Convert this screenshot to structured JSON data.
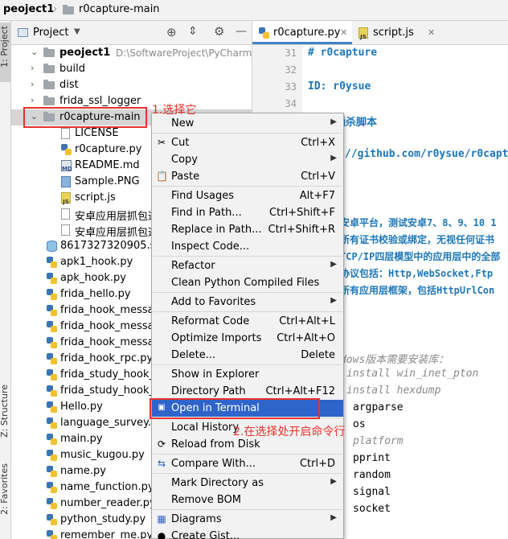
{
  "breadcrumb": {
    "project": "peoject1",
    "folder": "r0capture-main"
  },
  "side_tabs": {
    "project": "1: Project",
    "structure": "Z: Structure",
    "favorites": "2: Favorites"
  },
  "project_panel": {
    "title": "Project"
  },
  "tree": {
    "root": {
      "label": "peoject1",
      "path": "D:\\SoftwareProject\\PyCharmProject"
    },
    "folders": [
      "build",
      "dist",
      "frida_ssl_logger",
      "r0capture-main"
    ],
    "children": [
      "LICENSE",
      "r0capture.py",
      "README.md",
      "Sample.PNG",
      "script.js",
      "安卓应用层抓包通",
      "安卓应用层抓包通"
    ],
    "files": [
      "8617327320905.ses",
      "apk1_hook.py",
      "apk_hook.py",
      "frida_hello.py",
      "frida_hook_messag",
      "frida_hook_messag",
      "frida_hook_messag",
      "frida_hook_rpc.py",
      "frida_study_hook_ja",
      "frida_study_hook_ja",
      "Hello.py",
      "language_survey.py",
      "main.py",
      "music_kugou.py",
      "name.py",
      "name_function.py",
      "number_reader.py",
      "python_study.py",
      "remember_me.py"
    ]
  },
  "editor": {
    "tabs": [
      "r0capture.py",
      "script.js"
    ],
    "line_numbers": [
      "31",
      "32",
      "33",
      "34"
    ],
    "lines": [
      "# r0capture",
      "",
      "ID: r0ysue",
      "",
      "用层抓包通杀脚本",
      "",
      "//github.com/r0ysue/r0captu",
      "、",
      "",
      "安卓平台，测试安卓7、8、9、10 1",
      "所有证书校验或绑定，无视任何证书",
      "TCP/IP四层模型中的应用层中的全部",
      "协议包括：Http,WebSocket,Ftp",
      "所有应用层框架，包括HttpUrlCon",
      "",
      "",
      "",
      "dows版本需要安装库：",
      "install win_inet_pton",
      "install hexdump",
      "argparse",
      "os",
      "platform",
      "pprint",
      "random",
      "signal",
      "socket"
    ]
  },
  "context_menu": [
    {
      "label": "New",
      "shortcut": "",
      "submenu": true,
      "icon": ""
    },
    {
      "label": "Cut",
      "shortcut": "Ctrl+X",
      "submenu": false,
      "icon": "scissors-icon"
    },
    {
      "label": "Copy",
      "shortcut": "",
      "submenu": true,
      "icon": ""
    },
    {
      "label": "Paste",
      "shortcut": "Ctrl+V",
      "submenu": false,
      "icon": "clipboard-icon"
    },
    {
      "label": "Find Usages",
      "shortcut": "Alt+F7",
      "submenu": false,
      "icon": ""
    },
    {
      "label": "Find in Path...",
      "shortcut": "Ctrl+Shift+F",
      "submenu": false,
      "icon": ""
    },
    {
      "label": "Replace in Path...",
      "shortcut": "Ctrl+Shift+R",
      "submenu": false,
      "icon": ""
    },
    {
      "label": "Inspect Code...",
      "shortcut": "",
      "submenu": false,
      "icon": ""
    },
    {
      "label": "Refactor",
      "shortcut": "",
      "submenu": true,
      "icon": ""
    },
    {
      "label": "Clean Python Compiled Files",
      "shortcut": "",
      "submenu": false,
      "icon": ""
    },
    {
      "label": "Add to Favorites",
      "shortcut": "",
      "submenu": true,
      "icon": ""
    },
    {
      "label": "Reformat Code",
      "shortcut": "Ctrl+Alt+L",
      "submenu": false,
      "icon": ""
    },
    {
      "label": "Optimize Imports",
      "shortcut": "Ctrl+Alt+O",
      "submenu": false,
      "icon": ""
    },
    {
      "label": "Delete...",
      "shortcut": "Delete",
      "submenu": false,
      "icon": ""
    },
    {
      "label": "Show in Explorer",
      "shortcut": "",
      "submenu": false,
      "icon": ""
    },
    {
      "label": "Directory Path",
      "shortcut": "Ctrl+Alt+F12",
      "submenu": false,
      "icon": ""
    },
    {
      "label": "Open in Terminal",
      "shortcut": "",
      "submenu": false,
      "icon": "terminal-icon"
    },
    {
      "label": "Local History",
      "shortcut": "",
      "submenu": true,
      "icon": ""
    },
    {
      "label": "Reload from Disk",
      "shortcut": "",
      "submenu": false,
      "icon": "reload-icon"
    },
    {
      "label": "Compare With...",
      "shortcut": "Ctrl+D",
      "submenu": false,
      "icon": "compare-icon"
    },
    {
      "label": "Mark Directory as",
      "shortcut": "",
      "submenu": true,
      "icon": ""
    },
    {
      "label": "Remove BOM",
      "shortcut": "",
      "submenu": false,
      "icon": ""
    },
    {
      "label": "Diagrams",
      "shortcut": "",
      "submenu": true,
      "icon": "diagram-icon"
    },
    {
      "label": "Create Gist...",
      "shortcut": "",
      "submenu": false,
      "icon": "github-icon"
    }
  ],
  "annotations": {
    "step1": "1.选择它",
    "step2": "2.在选择处开启命令行"
  },
  "colors": {
    "highlight": "#2f65ca",
    "annotation": "#e8322c",
    "selected_row": "#d5d5d5"
  }
}
